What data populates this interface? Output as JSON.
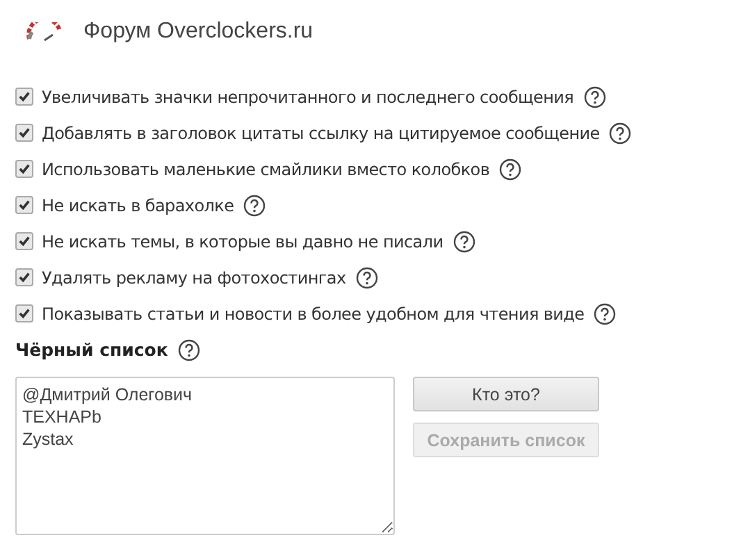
{
  "header": {
    "title": "Форум Overclockers.ru"
  },
  "options": [
    {
      "label": "Увеличивать значки непрочитанного и последнего сообщения",
      "checked": true
    },
    {
      "label": "Добавлять в заголовок цитаты ссылку на цитируемое сообщение",
      "checked": true
    },
    {
      "label": "Использовать маленькие смайлики вместо колобков",
      "checked": true
    },
    {
      "label": "Не искать в барахолке",
      "checked": true
    },
    {
      "label": "Не искать темы, в которые вы давно не писали",
      "checked": true
    },
    {
      "label": "Удалять рекламу на фотохостингах",
      "checked": true
    },
    {
      "label": "Показывать статьи и новости в более удобном для чтения виде",
      "checked": true
    }
  ],
  "blacklist": {
    "title": "Чёрный список",
    "value": [
      "@Дмитрий Олегович",
      "ТЕХНАРb",
      "Zystax"
    ]
  },
  "buttons": [
    {
      "label": "Кто это?",
      "disabled": false
    },
    {
      "label": "Сохранить список",
      "disabled": true
    }
  ]
}
